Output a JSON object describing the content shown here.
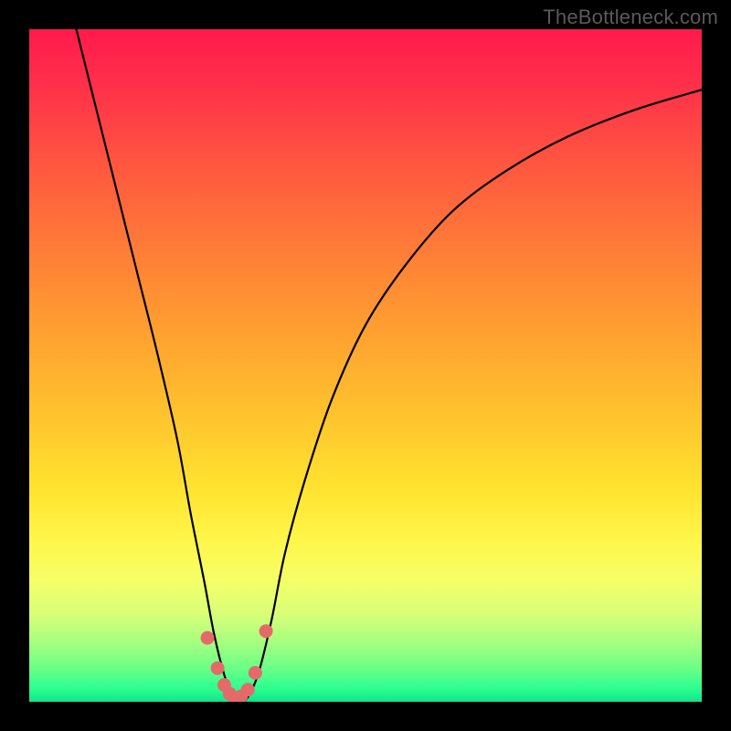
{
  "watermark": "TheBottleneck.com",
  "chart_data": {
    "type": "line",
    "title": "",
    "xlabel": "",
    "ylabel": "",
    "xlim": [
      0,
      100
    ],
    "ylim": [
      0,
      100
    ],
    "series": [
      {
        "name": "curve",
        "x": [
          7,
          10,
          13,
          16,
          19,
          22,
          24,
          26,
          27.5,
          29,
          30.5,
          32,
          34,
          36,
          38,
          41,
          45,
          50,
          56,
          63,
          71,
          80,
          90,
          100
        ],
        "y": [
          100,
          88,
          76,
          64,
          52,
          39,
          28,
          18,
          10,
          4,
          0,
          0,
          4,
          12,
          22,
          33,
          45,
          56,
          65,
          73,
          79,
          84,
          88,
          91
        ]
      }
    ],
    "markers": {
      "name": "highlight-dots",
      "color": "#e46a6a",
      "x": [
        26.5,
        28.0,
        29.0,
        29.8,
        30.6,
        31.5,
        32.5,
        33.6,
        35.2
      ],
      "y": [
        9.5,
        5.0,
        2.5,
        1.2,
        0.6,
        0.8,
        1.8,
        4.3,
        10.5
      ]
    },
    "background_gradient": {
      "stops": [
        {
          "pos": 0.0,
          "color": "#ff1a4d"
        },
        {
          "pos": 0.2,
          "color": "#ff5640"
        },
        {
          "pos": 0.45,
          "color": "#ffa030"
        },
        {
          "pos": 0.68,
          "color": "#ffe22f"
        },
        {
          "pos": 0.82,
          "color": "#f5ff68"
        },
        {
          "pos": 0.95,
          "color": "#6bff86"
        },
        {
          "pos": 1.0,
          "color": "#12e38d"
        }
      ]
    }
  }
}
